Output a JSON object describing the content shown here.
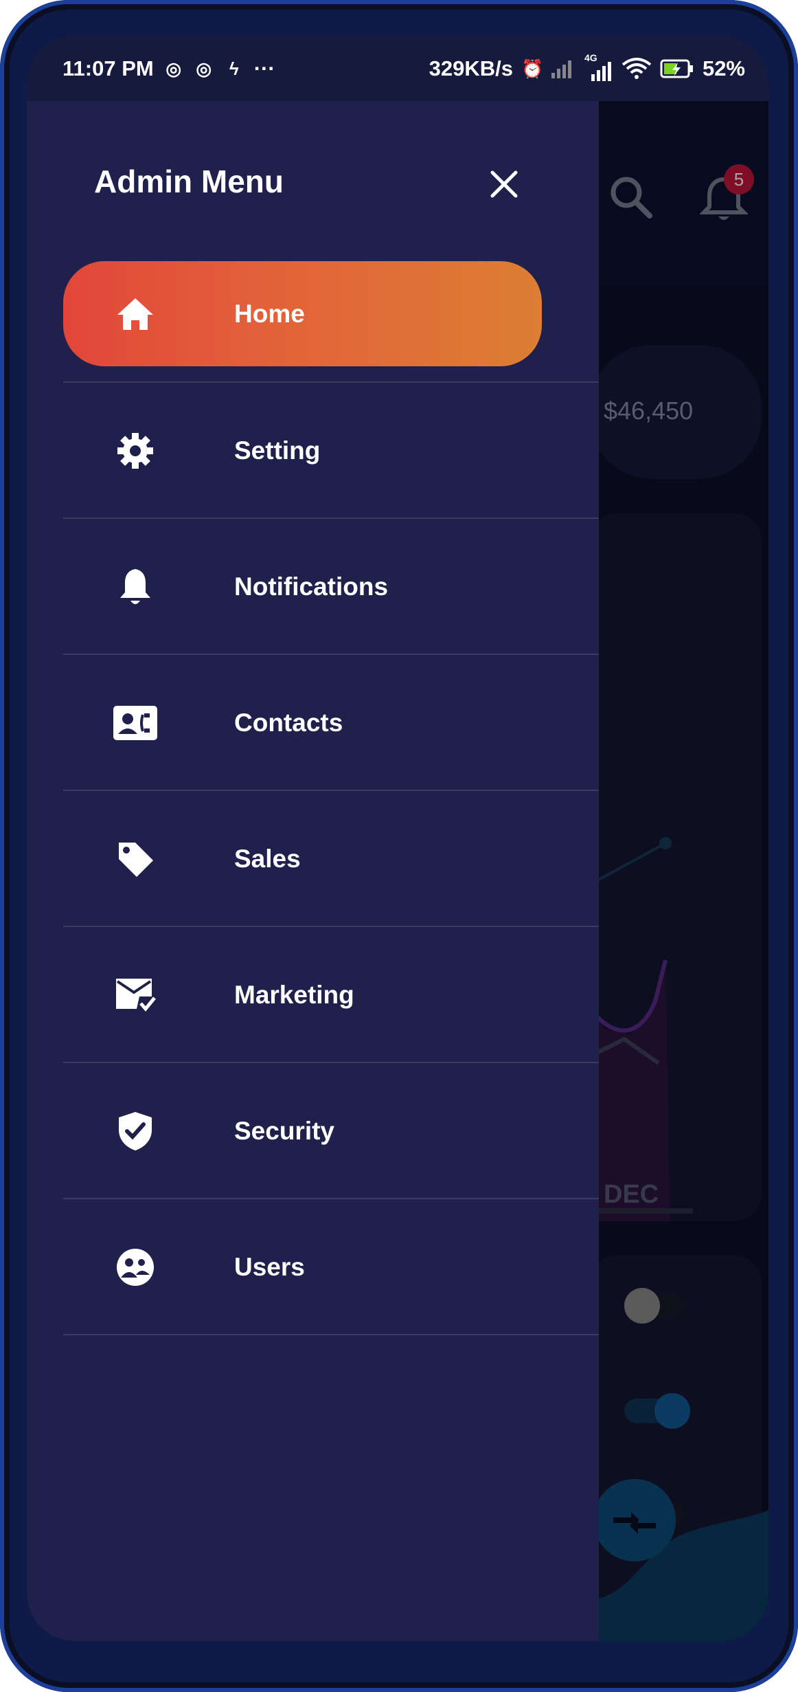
{
  "status_bar": {
    "time": "11:07 PM",
    "more": "···",
    "network_speed": "329KB/s",
    "network_type": "4G",
    "battery": "52%"
  },
  "background": {
    "notification_count": "5",
    "amount": "$46,450",
    "chart_month": "DEC"
  },
  "drawer": {
    "title": "Admin Menu",
    "items": [
      {
        "label": "Home",
        "icon": "home-icon",
        "active": true
      },
      {
        "label": "Setting",
        "icon": "gear-icon"
      },
      {
        "label": "Notifications",
        "icon": "bell-icon"
      },
      {
        "label": "Contacts",
        "icon": "contact-card-icon"
      },
      {
        "label": "Sales",
        "icon": "tag-icon"
      },
      {
        "label": "Marketing",
        "icon": "mail-check-icon"
      },
      {
        "label": "Security",
        "icon": "shield-check-icon"
      },
      {
        "label": "Users",
        "icon": "users-icon"
      }
    ]
  },
  "colors": {
    "drawer_bg": "#1f204b",
    "active_gradient_start": "#e2463a",
    "active_gradient_end": "#dc7e33",
    "badge": "#c1163a"
  }
}
